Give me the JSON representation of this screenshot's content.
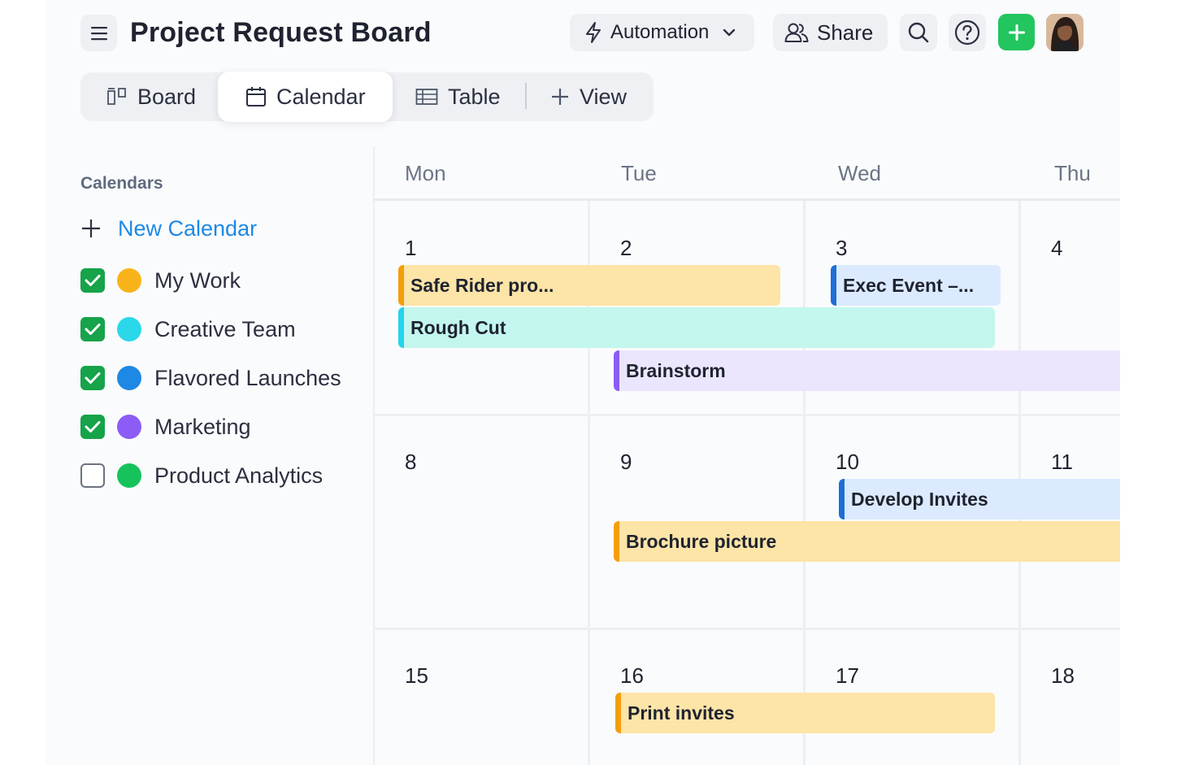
{
  "header": {
    "title": "Project Request Board",
    "automation_label": "Automation",
    "share_label": "Share"
  },
  "icons": {
    "menu": "hamburger-menu-icon",
    "automation": "lightning-bolt-icon",
    "automation_caret": "chevron-down-icon",
    "share": "people-icon",
    "search": "search-icon",
    "help": "question-circle-icon",
    "add": "plus-icon",
    "board": "board-columns-icon",
    "calendar": "calendar-icon",
    "table": "table-grid-icon",
    "view": "plus-icon"
  },
  "tabs": [
    {
      "label": "Board",
      "active": false
    },
    {
      "label": "Calendar",
      "active": true
    },
    {
      "label": "Table",
      "active": false
    },
    {
      "label": "View",
      "active": false
    }
  ],
  "sidebar": {
    "heading": "Calendars",
    "new_calendar_label": "New Calendar",
    "items": [
      {
        "label": "My Work",
        "checked": true,
        "color": "#f9b31a"
      },
      {
        "label": "Creative Team",
        "checked": true,
        "color": "#2ad8ea"
      },
      {
        "label": "Flavored Launches",
        "checked": true,
        "color": "#1e88e5"
      },
      {
        "label": "Marketing",
        "checked": true,
        "color": "#8b5cf6"
      },
      {
        "label": "Product Analytics",
        "checked": false,
        "color": "#16c35b"
      }
    ]
  },
  "calendar": {
    "days": [
      "Mon",
      "Tue",
      "Wed",
      "Thu"
    ],
    "weeks": [
      {
        "dates": [
          "1",
          "2",
          "3",
          "4"
        ]
      },
      {
        "dates": [
          "8",
          "9",
          "10",
          "11"
        ]
      },
      {
        "dates": [
          "15",
          "16",
          "17",
          "18"
        ]
      }
    ],
    "events": [
      {
        "label": "Safe Rider pro...",
        "color": "#fde4a7",
        "accent": "#f59e0b"
      },
      {
        "label": "Exec Event –...",
        "color": "#dbeafe",
        "accent": "#1d6fd6"
      },
      {
        "label": "Rough Cut",
        "color": "#c3f7ee",
        "accent": "#22d3ee"
      },
      {
        "label": "Brainstorm",
        "color": "#ebe6fd",
        "accent": "#8b5cf6"
      },
      {
        "label": "Develop Invites",
        "color": "#dbeafe",
        "accent": "#1d6fd6"
      },
      {
        "label": "Brochure picture",
        "color": "#fde4a7",
        "accent": "#f59e0b"
      },
      {
        "label": "Print invites",
        "color": "#fde4a7",
        "accent": "#f59e0b"
      }
    ]
  },
  "colors": {
    "brand_green": "#22c55e",
    "link_blue": "#1e88e5",
    "check_green": "#16a34a"
  }
}
